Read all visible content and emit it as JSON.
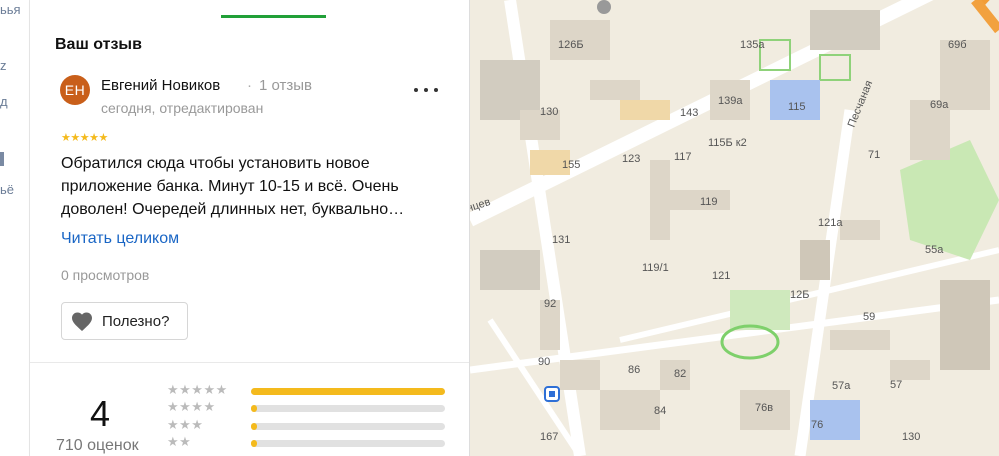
{
  "left_strip": {
    "fragment_top": "ьья",
    "fragment_mid": "z",
    "fragment_mid2": "д",
    "fragment_bottom": "ьё"
  },
  "panel": {
    "title": "Ваш отзыв",
    "review": {
      "avatar_initials": "ЕН",
      "author": "Евгений Новиков",
      "separator": "·",
      "reviews_count": "1 отзыв",
      "date": "сегодня, отредактирован",
      "rating_stars": "★★★★★",
      "rating": 5,
      "text": "Обратился сюда чтобы установить новое приложение банка. Минут 10-15 и всё. Очень доволен! Очередей длинных нет, буквально…",
      "read_more": "Читать целиком",
      "views": "0 просмотров",
      "useful_label": "Полезно?"
    },
    "summary": {
      "average": "4",
      "ratings_count": "710 оценок",
      "distribution": [
        {
          "stars": "★★★★★",
          "fraction": 1.0
        },
        {
          "stars": "★★★★",
          "fraction": 0.03
        },
        {
          "stars": "★★★",
          "fraction": 0.03
        },
        {
          "stars": "★★",
          "fraction": 0.03
        }
      ]
    }
  },
  "map": {
    "street_labels": [
      "Песчаная",
      "нцев"
    ],
    "building_labels": [
      "126Б",
      "135а",
      "69б",
      "130",
      "143",
      "139а",
      "115",
      "69а",
      "155",
      "123",
      "117",
      "115Б к2",
      "71",
      "119",
      "121а",
      "131",
      "55а",
      "119/1",
      "121",
      "12Б",
      "92",
      "59",
      "90",
      "86",
      "82",
      "57а",
      "57",
      "84",
      "76в",
      "76",
      "167",
      "130"
    ],
    "colors": {
      "land": "#f1ece0",
      "road": "#ffffff",
      "building": "#ddd6c8",
      "park": "#c9e8b4",
      "school": "#a9c2ee"
    }
  }
}
